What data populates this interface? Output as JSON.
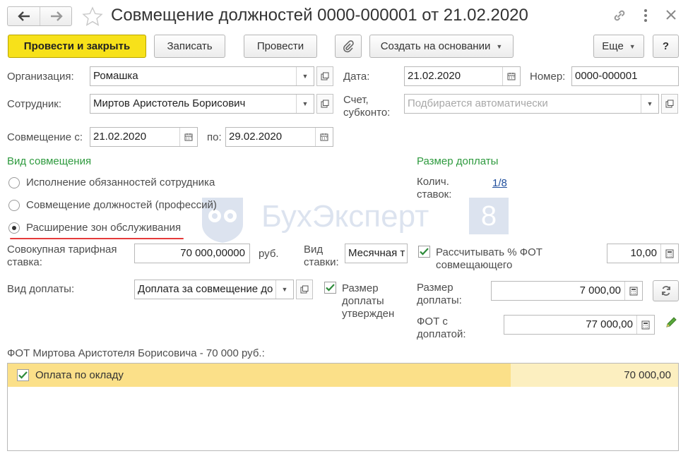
{
  "header": {
    "title": "Совмещение должностей 0000-000001 от 21.02.2020"
  },
  "toolbar": {
    "post_close": "Провести и закрыть",
    "save": "Записать",
    "post": "Провести",
    "create_based": "Создать на основании",
    "more": "Еще",
    "help": "?"
  },
  "form": {
    "org_label": "Организация:",
    "org_value": "Ромашка",
    "date_label": "Дата:",
    "date_value": "21.02.2020",
    "number_label": "Номер:",
    "number_value": "0000-000001",
    "employee_label": "Сотрудник:",
    "employee_value": "Миртов Аристотель Борисович",
    "account_label": "Счет,\nсубконто:",
    "account_placeholder": "Подбирается автоматически",
    "combine_from_label": "Совмещение с:",
    "combine_from_value": "21.02.2020",
    "combine_to_label": "по:",
    "combine_to_value": "29.02.2020"
  },
  "kind": {
    "title": "Вид совмещения",
    "options": [
      {
        "label": "Исполнение обязанностей сотрудника",
        "selected": false
      },
      {
        "label": "Совмещение должностей (профессий)",
        "selected": false
      },
      {
        "label": "Расширение зон обслуживания",
        "selected": true
      }
    ]
  },
  "surcharge": {
    "title": "Размер доплаты",
    "rates_label": "Колич.\nставок:",
    "rates_value": "1/8",
    "tariff_label": "Совокупная тарифная\nставка:",
    "tariff_value": "70 000,00000",
    "tariff_unit": "руб.",
    "rate_kind_label": "Вид\nставки:",
    "rate_kind_value": "Месячная т",
    "calc_percent_label": "Рассчитывать % ФОТ\nсовмещающего",
    "calc_percent_checked": true,
    "percent_value": "10,00",
    "pay_kind_label": "Вид доплаты:",
    "pay_kind_value": "Доплата за совмещение до",
    "approved_label": "Размер\nдоплаты\nутвержден",
    "approved_checked": true,
    "amount_label": "Размер\nдоплаты:",
    "amount_value": "7 000,00",
    "fot_label": "ФОТ с\nдоплатой:",
    "fot_value": "77 000,00"
  },
  "watermark": {
    "text": "БухЭксперт",
    "badge": "8"
  },
  "table": {
    "caption": "ФОТ Миртова Аристотеля Борисовича - 70 000 руб.:",
    "rows": [
      {
        "checked": true,
        "name": "Оплата по окладу",
        "amount": "70 000,00"
      }
    ]
  },
  "colors": {
    "accent_yellow": "#f7e11a",
    "section_green": "#2e9a3e",
    "row_highlight": "#fbe089",
    "underline_red": "#e53a3a",
    "link_blue": "#1f4e9c"
  }
}
